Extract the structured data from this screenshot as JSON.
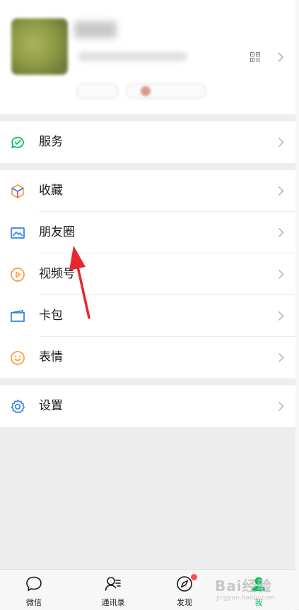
{
  "menu": {
    "service": {
      "label": "服务",
      "icon": "service-icon"
    },
    "favorites": {
      "label": "收藏",
      "icon": "favorites-cube-icon"
    },
    "moments": {
      "label": "朋友圈",
      "icon": "moments-image-icon"
    },
    "channels": {
      "label": "视频号",
      "icon": "channels-play-icon"
    },
    "cards": {
      "label": "卡包",
      "icon": "card-wallet-icon"
    },
    "stickers": {
      "label": "表情",
      "icon": "sticker-smile-icon"
    },
    "settings": {
      "label": "设置",
      "icon": "gear-icon"
    }
  },
  "tabbar": {
    "chats": {
      "label": "微信",
      "icon": "chat-bubble-icon"
    },
    "contacts": {
      "label": "通讯录",
      "icon": "contacts-icon"
    },
    "discover": {
      "label": "发现",
      "icon": "compass-icon"
    },
    "me": {
      "label": "我",
      "icon": "person-icon",
      "active": true
    }
  },
  "watermark": {
    "main": "Bai经验",
    "sub": "jingyan.baidu.com"
  },
  "colors": {
    "accent_green": "#07c160",
    "background": "#ededed",
    "annotation_red": "#e8262b",
    "badge_red": "#fa5151",
    "icon_green": "#07c160",
    "icon_blue": "#2e7cf6",
    "icon_orange": "#fa9d3b"
  }
}
